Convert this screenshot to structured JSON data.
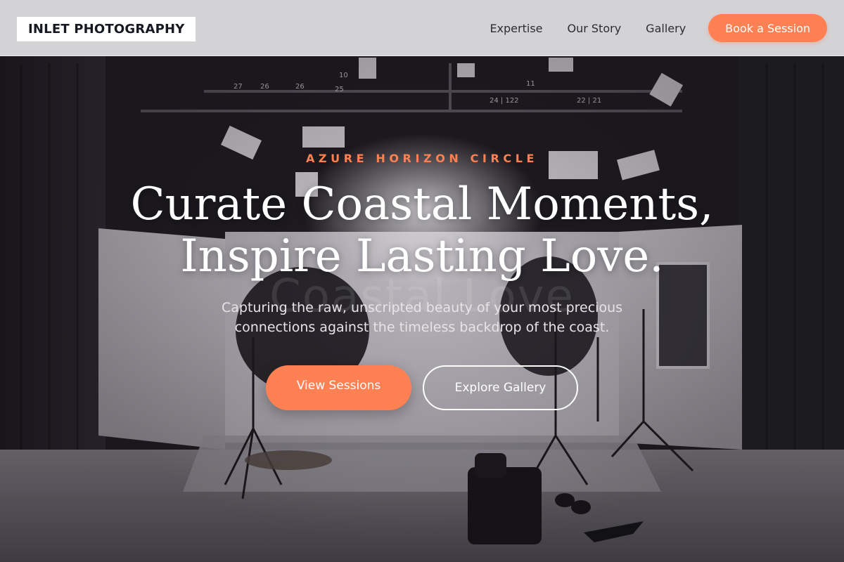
{
  "header": {
    "logo": "INLET PHOTOGRAPHY",
    "nav": [
      {
        "label": "Expertise"
      },
      {
        "label": "Our Story"
      },
      {
        "label": "Gallery"
      }
    ],
    "cta_label": "Book a Session"
  },
  "hero": {
    "eyebrow": "AZURE HORIZON CIRCLE",
    "headline_line1": "Curate Coastal Moments,",
    "headline_line2": "Inspire Lasting Love.",
    "ghost_text": "Coastal Love",
    "subtitle": "Capturing the raw, unscripted beauty of your most precious connections against the timeless backdrop of the coast.",
    "primary_button": "View Sessions",
    "secondary_button": "Explore Gallery"
  },
  "colors": {
    "accent": "#ff8052",
    "header_bg": "#e2e2e4",
    "text_dark": "#151922"
  }
}
